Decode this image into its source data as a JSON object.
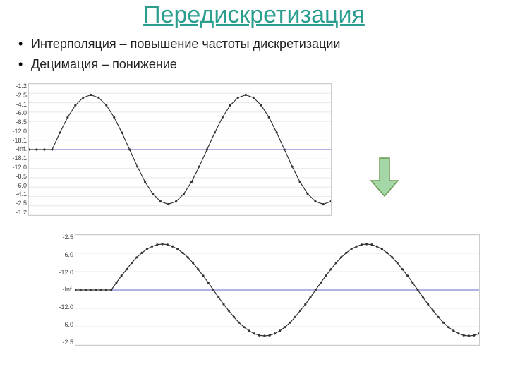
{
  "title": "Передискретизация",
  "bullets": [
    "Интерполяция – повышение частоты дискретизации",
    "Децимация – понижение"
  ],
  "arrow": {
    "fill": "#a5d6a7",
    "stroke": "#6a994e"
  },
  "chart_data": [
    {
      "type": "line",
      "title": "",
      "xlabel": "",
      "ylabel": "",
      "y_tick_labels": [
        "-1.2",
        "-2.5",
        "-4.1",
        "-6.0",
        "-8.5",
        "-12.0",
        "-18.1",
        "-Inf.",
        "-18.1",
        "-12.0",
        "-8.5",
        "-6.0",
        "-4.1",
        "-2.5",
        "-1.2"
      ],
      "x": [
        0,
        1,
        2,
        3,
        4,
        5,
        6,
        7,
        8,
        9,
        10,
        11,
        12,
        13,
        14,
        15,
        16,
        17,
        18,
        19,
        20,
        21,
        22,
        23,
        24,
        25,
        26,
        27,
        28,
        29,
        30,
        31,
        32,
        33,
        34,
        35,
        36,
        37,
        38,
        39
      ],
      "values": [
        0,
        0,
        0,
        0,
        0.31,
        0.59,
        0.81,
        0.95,
        1.0,
        0.95,
        0.81,
        0.59,
        0.31,
        0,
        -0.31,
        -0.59,
        -0.81,
        -0.95,
        -1.0,
        -0.95,
        -0.81,
        -0.59,
        -0.31,
        0,
        0.31,
        0.59,
        0.81,
        0.95,
        1.0,
        0.95,
        0.81,
        0.59,
        0.31,
        0,
        -0.31,
        -0.59,
        -0.81,
        -0.95,
        -1.0,
        -0.95
      ],
      "ylim": [
        -1.2,
        1.2
      ],
      "xlim": [
        0,
        39
      ],
      "baseline": 0,
      "stroke": "#333333",
      "baseline_stroke": "#6666cc"
    },
    {
      "type": "line",
      "title": "",
      "xlabel": "",
      "ylabel": "",
      "y_tick_labels": [
        "-2.5",
        "-6.0",
        "-12.0",
        "-Inf.",
        "-12.0",
        "-6.0",
        "-2.5"
      ],
      "x": [
        0,
        1,
        2,
        3,
        4,
        5,
        6,
        7,
        8,
        9,
        10,
        11,
        12,
        13,
        14,
        15,
        16,
        17,
        18,
        19,
        20,
        21,
        22,
        23,
        24,
        25,
        26,
        27,
        28,
        29,
        30,
        31,
        32,
        33,
        34,
        35,
        36,
        37,
        38,
        39,
        40,
        41,
        42,
        43,
        44,
        45,
        46,
        47,
        48,
        49,
        50,
        51,
        52,
        53,
        54,
        55,
        56,
        57,
        58,
        59,
        60,
        61,
        62,
        63,
        64,
        65,
        66,
        67,
        68,
        69,
        70,
        71,
        72,
        73,
        74,
        75,
        76,
        77,
        78,
        79
      ],
      "values": [
        0,
        0,
        0,
        0,
        0,
        0,
        0,
        0,
        0.16,
        0.31,
        0.45,
        0.59,
        0.71,
        0.81,
        0.89,
        0.95,
        0.99,
        1.0,
        0.99,
        0.95,
        0.89,
        0.81,
        0.71,
        0.59,
        0.45,
        0.31,
        0.16,
        0,
        -0.16,
        -0.31,
        -0.45,
        -0.59,
        -0.71,
        -0.81,
        -0.89,
        -0.95,
        -0.99,
        -1.0,
        -0.99,
        -0.95,
        -0.89,
        -0.81,
        -0.71,
        -0.59,
        -0.45,
        -0.31,
        -0.16,
        0,
        0.16,
        0.31,
        0.45,
        0.59,
        0.71,
        0.81,
        0.89,
        0.95,
        0.99,
        1.0,
        0.99,
        0.95,
        0.89,
        0.81,
        0.71,
        0.59,
        0.45,
        0.31,
        0.16,
        0,
        -0.16,
        -0.31,
        -0.45,
        -0.59,
        -0.71,
        -0.81,
        -0.89,
        -0.95,
        -0.99,
        -1.0,
        -0.99,
        -0.95
      ],
      "ylim": [
        -1.2,
        1.2
      ],
      "xlim": [
        0,
        79
      ],
      "baseline": 0,
      "stroke": "#333333",
      "baseline_stroke": "#6666cc"
    }
  ]
}
